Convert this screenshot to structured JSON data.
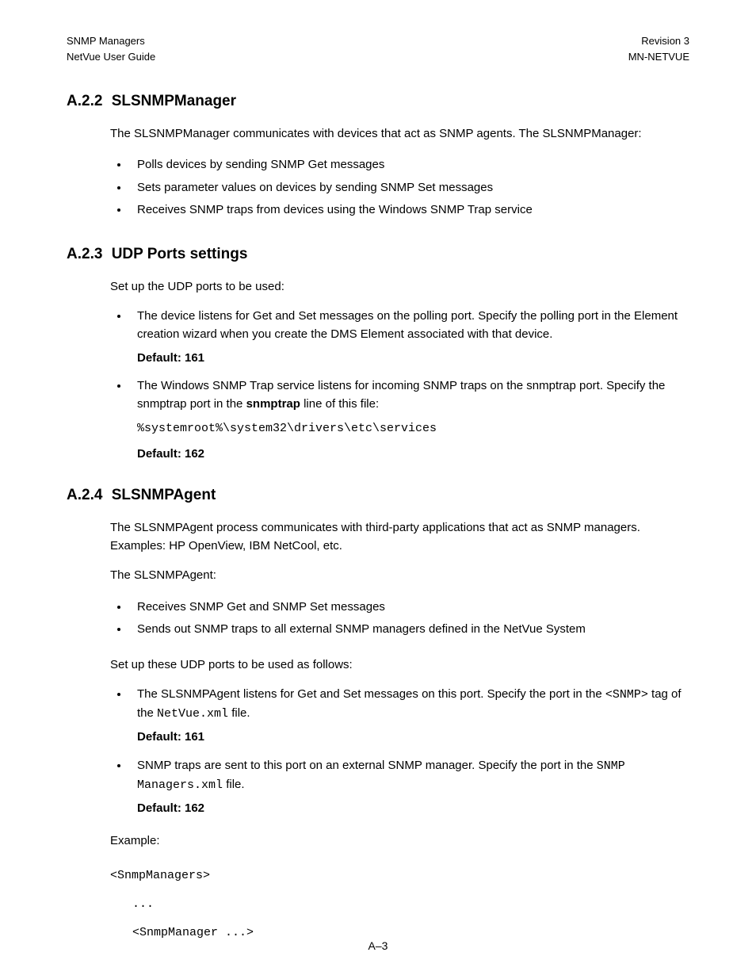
{
  "header": {
    "left1": "SNMP Managers",
    "left2": "NetVue User Guide",
    "right1": "Revision 3",
    "right2": "MN-NETVUE"
  },
  "section_a22": {
    "number": "A.2.2",
    "title": "SLSNMPManager",
    "intro": "The SLSNMPManager communicates with devices that act as SNMP agents. The SLSNMPManager:",
    "bullets": [
      "Polls devices by sending SNMP Get messages",
      "Sets parameter values on devices by sending SNMP Set messages",
      "Receives SNMP traps from devices using the Windows SNMP Trap service"
    ]
  },
  "section_a23": {
    "number": "A.2.3",
    "title": "UDP Ports settings",
    "intro": "Set up the UDP ports to be used:",
    "bullet1_text": "The device listens for Get and Set messages on the polling port. Specify the polling port in the Element creation wizard when you create the DMS Element associated with that device.",
    "bullet1_default": "Default: 161",
    "bullet2_text_a": "The Windows SNMP Trap service listens for incoming SNMP traps on the snmptrap port. Specify the snmptrap port in the ",
    "bullet2_bold": "snmptrap",
    "bullet2_text_b": " line of this file:",
    "bullet2_code": "%systemroot%\\system32\\drivers\\etc\\services",
    "bullet2_default": "Default: 162"
  },
  "section_a24": {
    "number": "A.2.4",
    "title": "SLSNMPAgent",
    "intro1": "The SLSNMPAgent process communicates with third-party applications that act as SNMP managers. Examples: HP OpenView, IBM NetCool, etc.",
    "intro2": "The SLSNMPAgent:",
    "bullets1": [
      "Receives SNMP Get and SNMP Set messages",
      "Sends out SNMP traps to all external SNMP managers defined in the NetVue System"
    ],
    "intro3": "Set up these UDP ports to be used as follows:",
    "bullet3_text_a": "The SLSNMPAgent listens for Get and Set messages on this port. Specify the port in the ",
    "bullet3_code_a": "<SNMP>",
    "bullet3_text_b": " tag of the ",
    "bullet3_code_b": "NetVue.xml",
    "bullet3_text_c": " file.",
    "bullet3_default": "Default: 161",
    "bullet4_text_a": "SNMP traps are sent  to this port on an external SNMP manager. Specify the port in the ",
    "bullet4_code": "SNMP Managers.xml",
    "bullet4_text_b": " file.",
    "bullet4_default": "Default: 162",
    "example_label": "Example:",
    "example_lines": {
      "l1": "<SnmpManagers>",
      "l2": "...",
      "l3": "<SnmpManager ...>"
    }
  },
  "footer": "A–3"
}
